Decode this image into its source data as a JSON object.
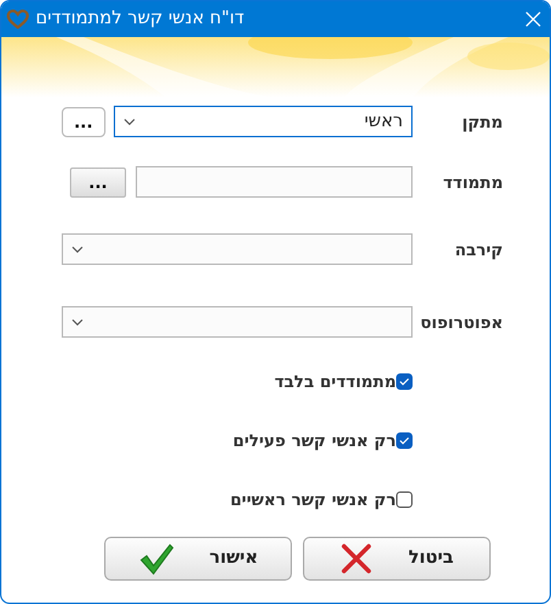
{
  "window": {
    "title": "דו\"ח אנשי קשר למתמודדים"
  },
  "fields": [
    {
      "label": "מתקן",
      "kind": "select",
      "value": "ראשי",
      "focused": true,
      "button": "..."
    },
    {
      "label": "מתמודד",
      "kind": "text",
      "focused": false,
      "button": "..."
    },
    {
      "label": "קירבה",
      "kind": "select",
      "focused": false
    },
    {
      "label": "אפוטרופוס",
      "kind": "select",
      "focused": false
    }
  ],
  "checkboxes": [
    {
      "label": "מתמודדים בלבד",
      "checked": true
    },
    {
      "label": "רק אנשי קשר פעילים",
      "checked": true
    },
    {
      "label": "רק אנשי קשר ראשיים",
      "checked": false
    }
  ],
  "buttons": [
    {
      "label": "ביטול",
      "kind": "cancel"
    },
    {
      "label": "אישור",
      "kind": "ok"
    }
  ]
}
